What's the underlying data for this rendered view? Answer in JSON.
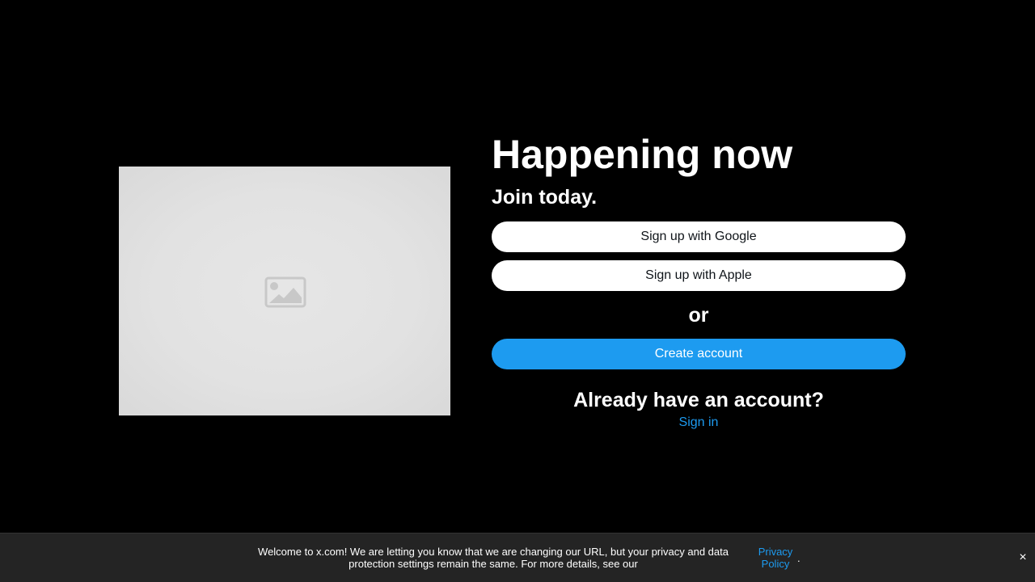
{
  "hero": {
    "image_icon": "image-placeholder-icon"
  },
  "main": {
    "headline": "Happening now",
    "subheadline": "Join today.",
    "google_button": "Sign up with Google",
    "apple_button": "Sign up with Apple",
    "or_divider": "or",
    "create_account_button": "Create account",
    "already_have_account": "Already have an account?",
    "sign_in_link": "Sign in"
  },
  "banner": {
    "message": "Welcome to x.com! We are letting you know that we are changing our URL, but your privacy and data protection settings remain the same. For more details, see our",
    "privacy_link": "Privacy Policy",
    "period": ".",
    "close_label": "×",
    "close_icon": "close-icon"
  },
  "colors": {
    "background": "#000000",
    "accent": "#1d9bf0",
    "banner_background": "#242424",
    "button_light": "#ffffff"
  }
}
